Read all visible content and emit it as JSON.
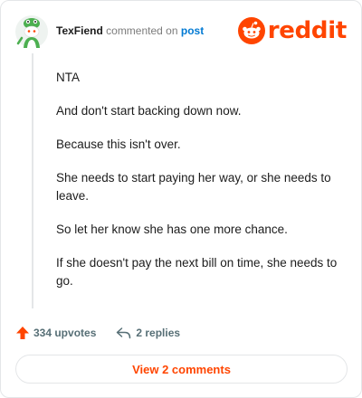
{
  "header": {
    "username": "TexFiend",
    "action_text": "commented on",
    "post_link": "post",
    "brand": "reddit",
    "avatar_icon": "snoo-avatar-icon",
    "brand_color": "#ff4500"
  },
  "comment": {
    "paragraphs": [
      "NTA",
      "And don't start backing down now.",
      "Because this isn't over.",
      "She needs to start paying her way, or she needs to leave.",
      "So let her know she has one more chance.",
      "If she doesn't pay the next bill on time, she needs to go."
    ]
  },
  "footer": {
    "upvotes_label": "334 upvotes",
    "upvote_icon": "upvote-arrow-icon",
    "replies_label": "2 replies",
    "reply_icon": "reply-arrow-icon"
  },
  "view_button": {
    "label": "View 2 comments"
  }
}
